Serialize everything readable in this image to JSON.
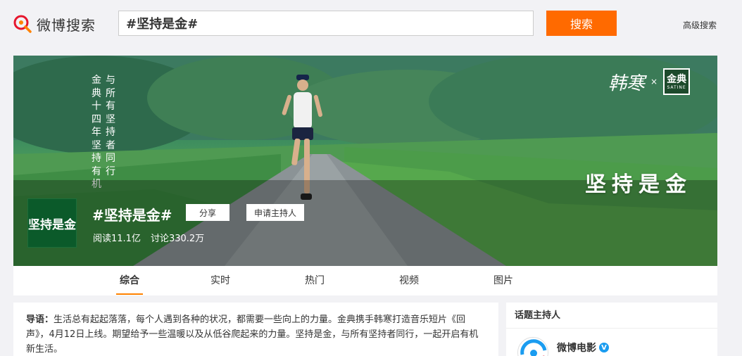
{
  "header": {
    "logo_text": "微博搜索",
    "search_value": "#坚持是金#",
    "search_button": "搜索",
    "advanced_link": "高级搜索"
  },
  "banner": {
    "vertical_col1": [
      "金",
      "典",
      "十",
      "四",
      "年",
      "坚",
      "持",
      "有",
      "机"
    ],
    "vertical_col2": [
      "与",
      "所",
      "有",
      "坚",
      "持",
      "者",
      "同",
      "行"
    ],
    "brand_signature": "韩寒",
    "brand_separator": "×",
    "brand_box_main": "金典",
    "brand_box_sub": "SATINE",
    "slogan": "坚持是金"
  },
  "topic": {
    "avatar_text": "坚持是金",
    "title": "#坚持是金#",
    "share_button": "分享",
    "apply_host_button": "申请主持人",
    "reads": "阅读11.1亿",
    "discussions": "讨论330.2万"
  },
  "tabs": [
    {
      "label": "综合",
      "active": true
    },
    {
      "label": "实时",
      "active": false
    },
    {
      "label": "热门",
      "active": false
    },
    {
      "label": "视频",
      "active": false
    },
    {
      "label": "图片",
      "active": false
    }
  ],
  "intro": {
    "lead": "导语：",
    "text": "生活总有起起落落，每个人遇到各种的状况，都需要一些向上的力量。金典携手韩寒打造音乐短片《回声》，4月12日上线。期望给予一些温暖以及从低谷爬起来的力量。坚持是金，与所有坚持者同行，一起开启有机新生活。"
  },
  "sidebar": {
    "title": "话题主持人",
    "host_name": "微博电影",
    "verified_mark": "V"
  },
  "colors": {
    "accent_orange": "#ff6a00",
    "tab_underline": "#ff8200",
    "verified_blue": "#1a9cf0"
  }
}
